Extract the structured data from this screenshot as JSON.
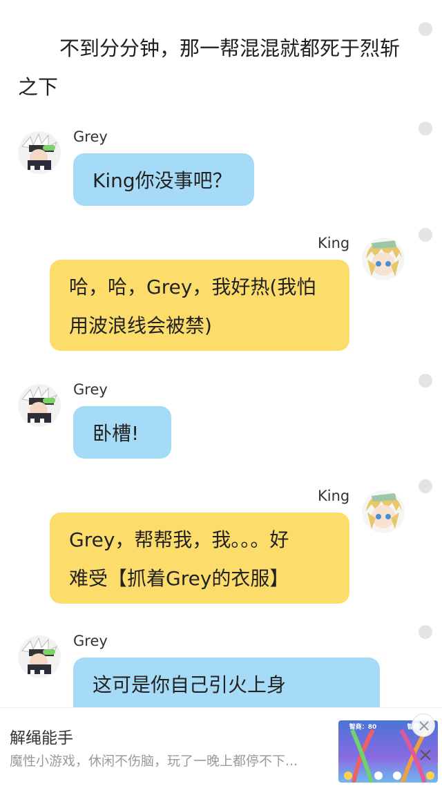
{
  "narration": {
    "text": "不到分分钟，那一帮混混就都死于烈斩之下"
  },
  "messages": [
    {
      "speaker": "Grey",
      "side": "left",
      "text": "King你没事吧？"
    },
    {
      "speaker": "King",
      "side": "right",
      "text_line1": "哈，哈，Grey，我好热(我怕",
      "text_line2": "用波浪线会被禁)"
    },
    {
      "speaker": "Grey",
      "side": "left",
      "text": "卧槽!"
    },
    {
      "speaker": "King",
      "side": "right",
      "text_line1": "Grey，帮帮我，我。。。好",
      "text_line2": "难受【抓着Grey的衣服】"
    },
    {
      "speaker": "Grey",
      "side": "left",
      "text": "这可是你自己引火上身"
    }
  ],
  "ad": {
    "title": "解绳能手",
    "description": "魔性小游戏，休闲不伤脑，玩了一晚上都停不下...",
    "score_left": "智商：80",
    "score_right": "智商"
  },
  "colors": {
    "grey_bubble": "#a6dbf7",
    "king_bubble": "#fcdc6a"
  }
}
